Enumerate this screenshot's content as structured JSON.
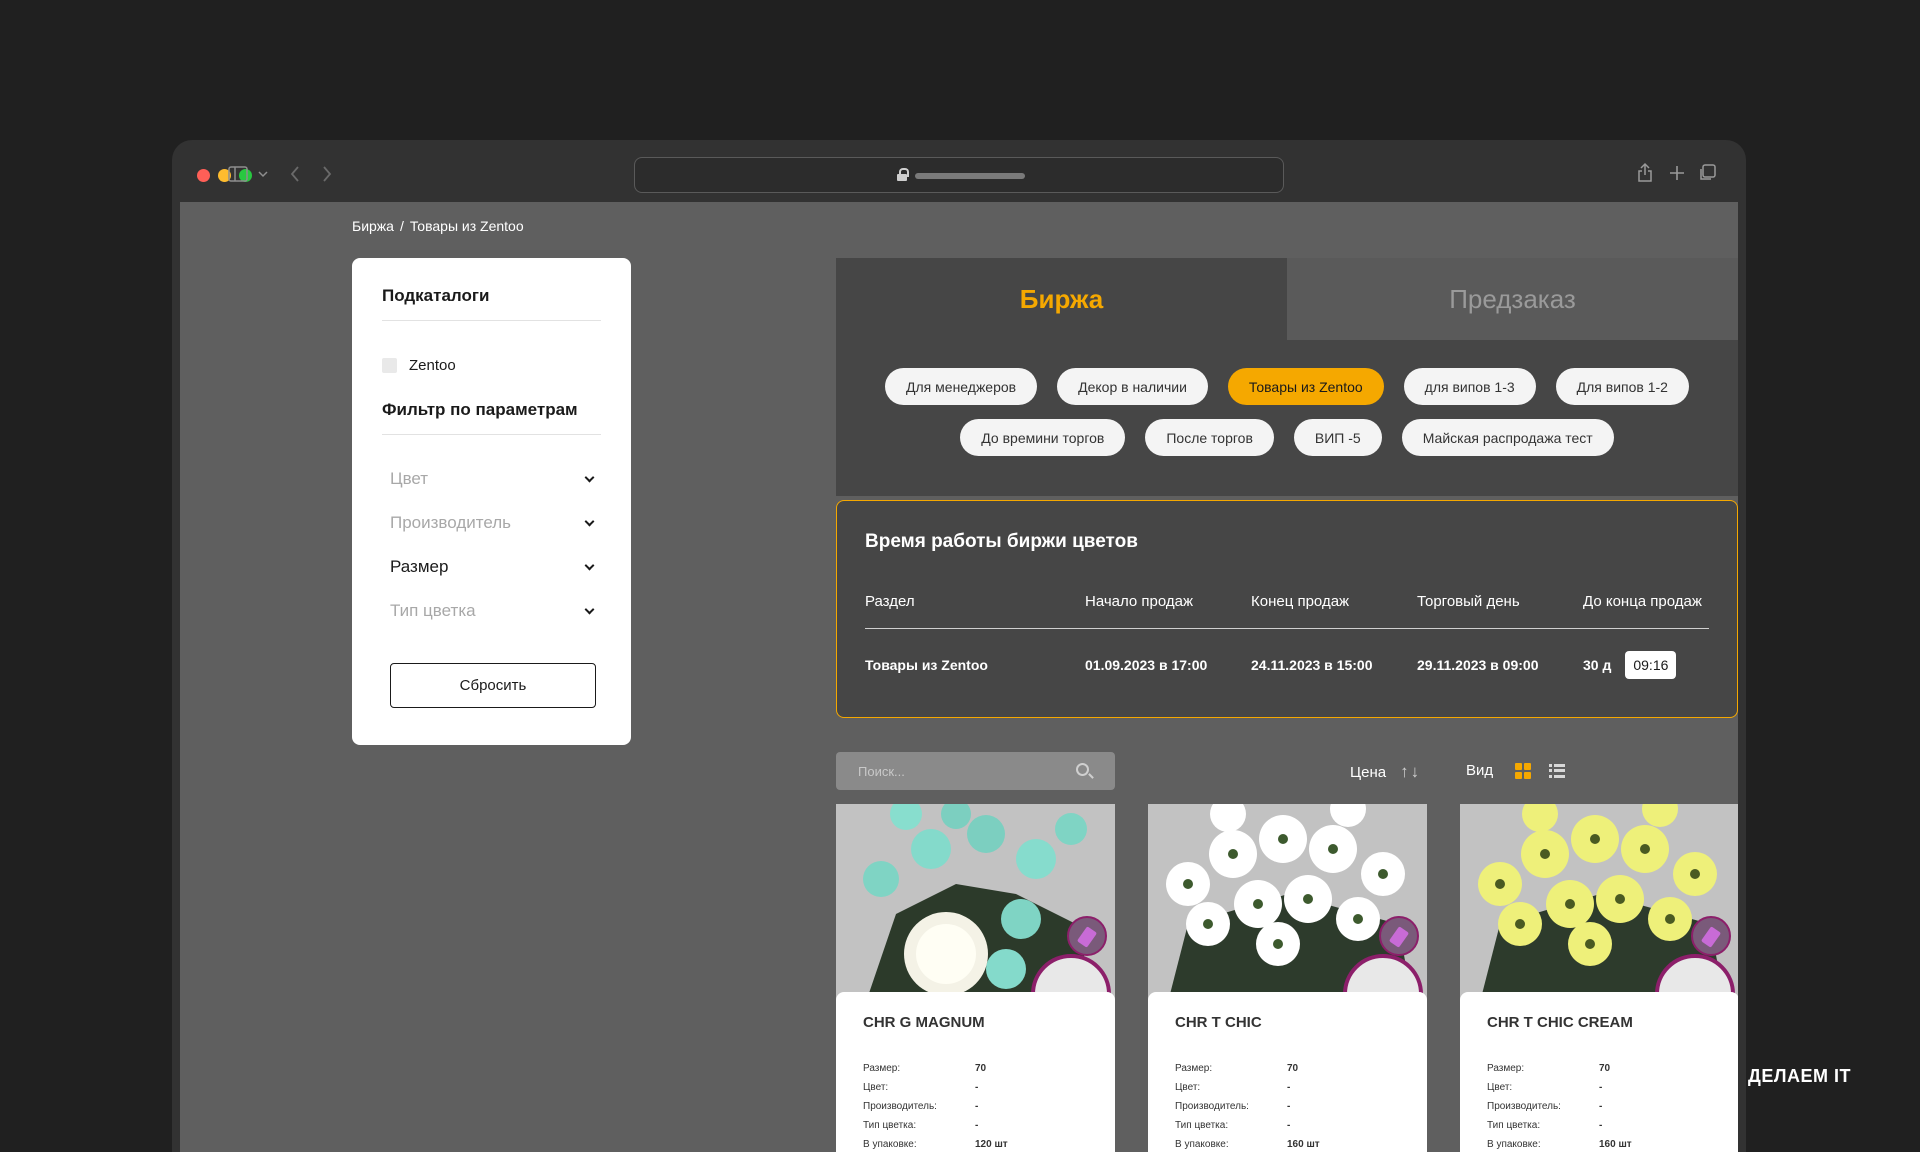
{
  "breadcrumb": {
    "root": "Биржа",
    "separator": "/",
    "current": "Товары из Zentoo"
  },
  "sidebar": {
    "subcatalogs_title": "Подкаталоги",
    "subcatalog_items": [
      "Zentoo"
    ],
    "filter_title": "Фильтр по параметрам",
    "filters": [
      "Цвет",
      "Производитель",
      "Размер",
      "Тип цветка"
    ],
    "reset_label": "Сбросить"
  },
  "tabs": {
    "exchange": "Биржа",
    "preorder": "Предзаказ"
  },
  "chips": [
    "Для менеджеров",
    "Декор в наличии",
    "Товары из Zentoo",
    "для випов 1-3",
    "Для випов 1-2",
    "До времини торгов",
    "После торгов",
    "ВИП -5",
    "Майская распродажа тест"
  ],
  "active_chip": "Товары из Zentoo",
  "schedule": {
    "title": "Время работы биржи цветов",
    "headers": [
      "Раздел",
      "Начало продаж",
      "Конец продаж",
      "Торговый день",
      "До конца продаж"
    ],
    "row": {
      "section": "Товары из Zentoo",
      "start": "01.09.2023 в 17:00",
      "end": "24.11.2023 в 15:00",
      "trade_day": "29.11.2023 в 09:00",
      "remaining_days": "30 д",
      "remaining_time": "09:16"
    }
  },
  "search": {
    "placeholder": "Поиск..."
  },
  "sort": {
    "label": "Цена",
    "arrows": "↑↓"
  },
  "view": {
    "label": "Вид"
  },
  "property_labels": [
    "Размер:",
    "Цвет:",
    "Производитель:",
    "Тип цветка:",
    "В упаковке:"
  ],
  "products": [
    {
      "name": "CHR G MAGNUM",
      "values": [
        "70",
        "-",
        "-",
        "-",
        "120 шт"
      ]
    },
    {
      "name": "CHR T CHIC",
      "values": [
        "70",
        "-",
        "-",
        "-",
        "160 шт"
      ]
    },
    {
      "name": "CHR T CHIC CREAM",
      "values": [
        "70",
        "-",
        "-",
        "-",
        "160 шт"
      ]
    }
  ],
  "watermark": "ДЕЛАЕМ IT",
  "colors": {
    "accent": "#f5a800",
    "page_bg": "#5f5f5f",
    "panel_bg": "#464646"
  }
}
